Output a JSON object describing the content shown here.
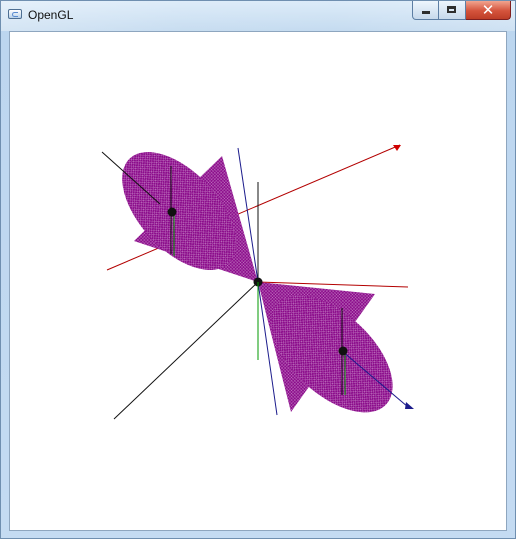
{
  "window": {
    "title": "OpenGL",
    "controls": {
      "minimize_icon": "minimize-icon",
      "maximize_icon": "maximize-icon",
      "close_icon": "close-icon",
      "close_glyph": "✕"
    }
  },
  "scene": {
    "background": "#ffffff",
    "axis_colors": {
      "x": "#b30000",
      "y": "#000000",
      "z": "#1c1c8c",
      "green_marker": "#009900"
    },
    "cone_color": "#8b0c8b",
    "joint_color": "#111111"
  }
}
